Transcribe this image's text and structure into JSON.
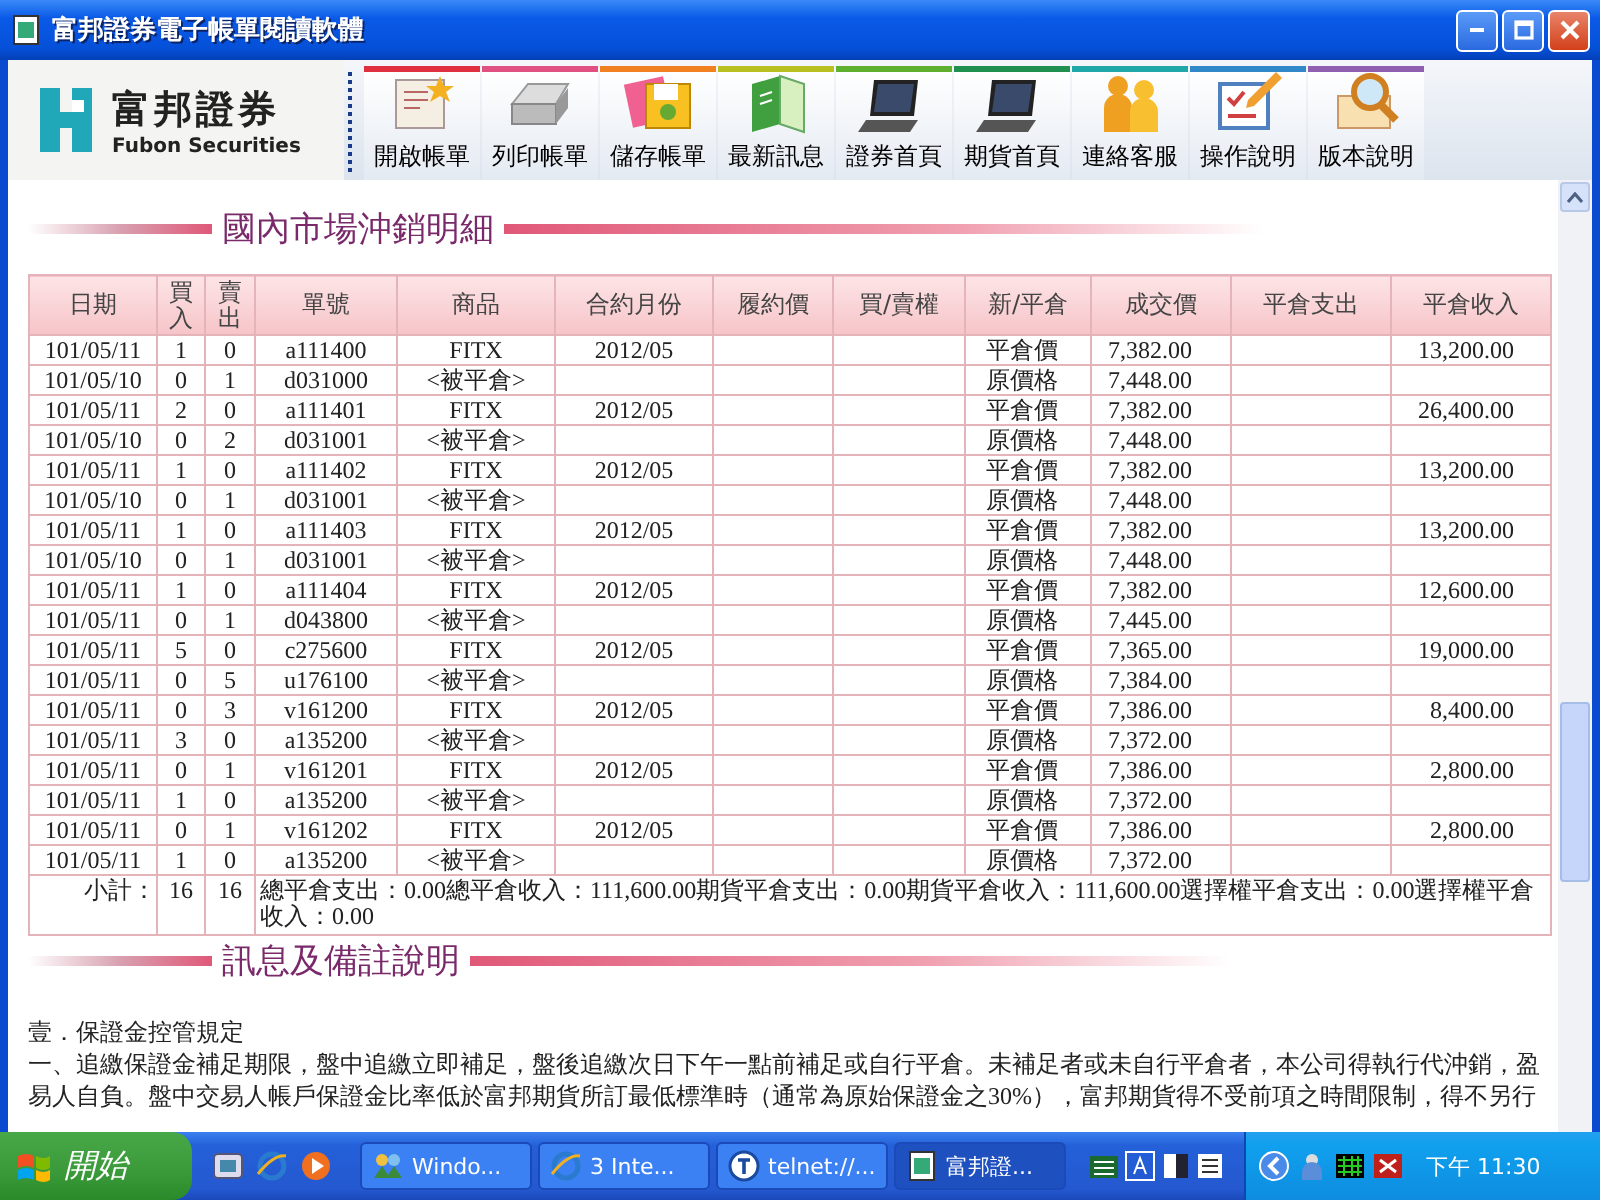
{
  "window": {
    "title": "富邦證券電子帳單閱讀軟體"
  },
  "logo": {
    "name": "富邦證券",
    "subtitle": "Fubon Securities"
  },
  "toolbar": [
    {
      "label": "開啟帳單",
      "kind": "open",
      "color": "#e03040"
    },
    {
      "label": "列印帳單",
      "kind": "print",
      "color": "#e05080"
    },
    {
      "label": "儲存帳單",
      "kind": "save",
      "color": "#f08020"
    },
    {
      "label": "最新訊息",
      "kind": "news",
      "color": "#b8c020"
    },
    {
      "label": "證券首頁",
      "kind": "laptop",
      "color": "#60b030"
    },
    {
      "label": "期貨首頁",
      "kind": "laptop",
      "color": "#209050"
    },
    {
      "label": "連絡客服",
      "kind": "people",
      "color": "#20a8a8"
    },
    {
      "label": "操作說明",
      "kind": "guide",
      "color": "#3088c8"
    },
    {
      "label": "版本說明",
      "kind": "version",
      "color": "#9060b0"
    }
  ],
  "trade_section": {
    "title": "國內市場沖銷明細",
    "columns": [
      "日期",
      "買入",
      "賣出",
      "單號",
      "商品",
      "合約月份",
      "履約價",
      "買/賣權",
      "新/平倉",
      "成交價",
      "平倉支出",
      "平倉收入"
    ],
    "rows": [
      {
        "date": "101/05/11",
        "buy": "1",
        "sell": "0",
        "order_no": "a111400",
        "product": "FITX",
        "contract_month": "2012/05",
        "open_close": "平倉價",
        "price": "7,382.00",
        "close_income": "13,200.00"
      },
      {
        "date": "101/05/10",
        "buy": "0",
        "sell": "1",
        "order_no": "d031000",
        "product": "<被平倉>",
        "open_close": "原價格",
        "price": "7,448.00"
      },
      {
        "date": "101/05/11",
        "buy": "2",
        "sell": "0",
        "order_no": "a111401",
        "product": "FITX",
        "contract_month": "2012/05",
        "open_close": "平倉價",
        "price": "7,382.00",
        "close_income": "26,400.00"
      },
      {
        "date": "101/05/10",
        "buy": "0",
        "sell": "2",
        "order_no": "d031001",
        "product": "<被平倉>",
        "open_close": "原價格",
        "price": "7,448.00"
      },
      {
        "date": "101/05/11",
        "buy": "1",
        "sell": "0",
        "order_no": "a111402",
        "product": "FITX",
        "contract_month": "2012/05",
        "open_close": "平倉價",
        "price": "7,382.00",
        "close_income": "13,200.00"
      },
      {
        "date": "101/05/10",
        "buy": "0",
        "sell": "1",
        "order_no": "d031001",
        "product": "<被平倉>",
        "open_close": "原價格",
        "price": "7,448.00"
      },
      {
        "date": "101/05/11",
        "buy": "1",
        "sell": "0",
        "order_no": "a111403",
        "product": "FITX",
        "contract_month": "2012/05",
        "open_close": "平倉價",
        "price": "7,382.00",
        "close_income": "13,200.00"
      },
      {
        "date": "101/05/10",
        "buy": "0",
        "sell": "1",
        "order_no": "d031001",
        "product": "<被平倉>",
        "open_close": "原價格",
        "price": "7,448.00"
      },
      {
        "date": "101/05/11",
        "buy": "1",
        "sell": "0",
        "order_no": "a111404",
        "product": "FITX",
        "contract_month": "2012/05",
        "open_close": "平倉價",
        "price": "7,382.00",
        "close_income": "12,600.00"
      },
      {
        "date": "101/05/11",
        "buy": "0",
        "sell": "1",
        "order_no": "d043800",
        "product": "<被平倉>",
        "open_close": "原價格",
        "price": "7,445.00"
      },
      {
        "date": "101/05/11",
        "buy": "5",
        "sell": "0",
        "order_no": "c275600",
        "product": "FITX",
        "contract_month": "2012/05",
        "open_close": "平倉價",
        "price": "7,365.00",
        "close_income": "19,000.00"
      },
      {
        "date": "101/05/11",
        "buy": "0",
        "sell": "5",
        "order_no": "u176100",
        "product": "<被平倉>",
        "open_close": "原價格",
        "price": "7,384.00"
      },
      {
        "date": "101/05/11",
        "buy": "0",
        "sell": "3",
        "order_no": "v161200",
        "product": "FITX",
        "contract_month": "2012/05",
        "open_close": "平倉價",
        "price": "7,386.00",
        "close_income": "8,400.00"
      },
      {
        "date": "101/05/11",
        "buy": "3",
        "sell": "0",
        "order_no": "a135200",
        "product": "<被平倉>",
        "open_close": "原價格",
        "price": "7,372.00"
      },
      {
        "date": "101/05/11",
        "buy": "0",
        "sell": "1",
        "order_no": "v161201",
        "product": "FITX",
        "contract_month": "2012/05",
        "open_close": "平倉價",
        "price": "7,386.00",
        "close_income": "2,800.00"
      },
      {
        "date": "101/05/11",
        "buy": "1",
        "sell": "0",
        "order_no": "a135200",
        "product": "<被平倉>",
        "open_close": "原價格",
        "price": "7,372.00"
      },
      {
        "date": "101/05/11",
        "buy": "0",
        "sell": "1",
        "order_no": "v161202",
        "product": "FITX",
        "contract_month": "2012/05",
        "open_close": "平倉價",
        "price": "7,386.00",
        "close_income": "2,800.00"
      },
      {
        "date": "101/05/11",
        "buy": "1",
        "sell": "0",
        "order_no": "a135200",
        "product": "<被平倉>",
        "open_close": "原價格",
        "price": "7,372.00"
      }
    ],
    "subtotal": {
      "label": "小計：",
      "buy": "16",
      "sell": "16",
      "summary": "總平倉支出：0.00總平倉收入：111,600.00期貨平倉支出：0.00期貨平倉收入：111,600.00選擇權平倉支出：0.00選擇權平倉收入：0.00"
    }
  },
  "notes_section": {
    "title": "訊息及備註說明",
    "heading": "壹．保證金控管規定",
    "lines": [
      "一、追繳保證金補足期限，盤中追繳立即補足，盤後追繳次日下午一點前補足或自行平倉。未補足者或未自行平倉者，本公司得執行代沖銷，盈",
      "易人自負。盤中交易人帳戶保證金比率低於富邦期貨所訂最低標準時（通常為原始保證金之30%），富邦期貨得不受前項之時間限制，得不另行"
    ]
  },
  "taskbar": {
    "start": "開始",
    "tasks": [
      {
        "label": "Windo...",
        "kind": "folder",
        "selected": false
      },
      {
        "label": "3 Inte...",
        "kind": "browser",
        "selected": false
      },
      {
        "label": "telnet://...",
        "kind": "telnet",
        "selected": false
      },
      {
        "label": "富邦證...",
        "kind": "app",
        "selected": true
      }
    ],
    "clock": "下午 11:30"
  }
}
